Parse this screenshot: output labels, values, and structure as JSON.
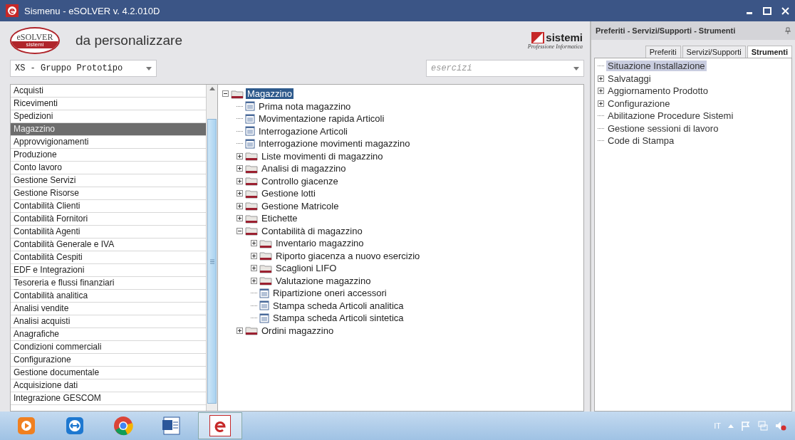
{
  "window": {
    "title": "Sismenu - eSOLVER v. 4.2.010D"
  },
  "header": {
    "logo": "eSOLVER",
    "logo_sub": "sistemi",
    "title": "da personalizzare",
    "brand": "sistemi",
    "brand_tagline": "Professione Informatica"
  },
  "company_select": {
    "value": "XS - Gruppo Prototipo"
  },
  "year_select": {
    "placeholder": "esercizi"
  },
  "modules": [
    {
      "label": "Acquisti",
      "selected": false
    },
    {
      "label": "Ricevimenti",
      "selected": false
    },
    {
      "label": "Spedizioni",
      "selected": false
    },
    {
      "label": "Magazzino",
      "selected": true
    },
    {
      "label": "Approvvigionamenti",
      "selected": false
    },
    {
      "label": "Produzione",
      "selected": false
    },
    {
      "label": "Conto lavoro",
      "selected": false
    },
    {
      "label": "Gestione Servizi",
      "selected": false
    },
    {
      "label": "Gestione Risorse",
      "selected": false
    },
    {
      "label": "Contabilità Clienti",
      "selected": false
    },
    {
      "label": "Contabilità Fornitori",
      "selected": false
    },
    {
      "label": "Contabilità Agenti",
      "selected": false
    },
    {
      "label": "Contabilità Generale e IVA",
      "selected": false
    },
    {
      "label": "Contabilità Cespiti",
      "selected": false
    },
    {
      "label": "EDF e Integrazioni",
      "selected": false
    },
    {
      "label": "Tesoreria e flussi finanziari",
      "selected": false
    },
    {
      "label": "Contabilità analitica",
      "selected": false
    },
    {
      "label": "Analisi vendite",
      "selected": false
    },
    {
      "label": "Analisi acquisti",
      "selected": false
    },
    {
      "label": "Anagrafiche",
      "selected": false
    },
    {
      "label": "Condizioni commerciali",
      "selected": false
    },
    {
      "label": "Configurazione",
      "selected": false
    },
    {
      "label": "Gestione documentale",
      "selected": false
    },
    {
      "label": "Acquisizione dati",
      "selected": false
    },
    {
      "label": "Integrazione GESCOM",
      "selected": false
    }
  ],
  "menu_tree": [
    {
      "label": "Magazzino",
      "kind": "folder",
      "expanded": true,
      "selected": true,
      "children": [
        {
          "label": "Prima nota magazzino",
          "kind": "doc",
          "selected": false
        },
        {
          "label": "Movimentazione rapida Articoli",
          "kind": "doc",
          "selected": false
        },
        {
          "label": "Interrogazione Articoli",
          "kind": "doc",
          "selected": false
        },
        {
          "label": "Interrogazione movimenti magazzino",
          "kind": "doc",
          "selected": false
        },
        {
          "label": "Liste movimenti di magazzino",
          "kind": "folder",
          "expanded": false,
          "selected": false
        },
        {
          "label": "Analisi di magazzino",
          "kind": "folder",
          "expanded": false,
          "selected": false
        },
        {
          "label": "Controllo giacenze",
          "kind": "folder",
          "expanded": false,
          "selected": false
        },
        {
          "label": "Gestione lotti",
          "kind": "folder",
          "expanded": false,
          "selected": false
        },
        {
          "label": "Gestione Matricole",
          "kind": "folder",
          "expanded": false,
          "selected": false
        },
        {
          "label": "Etichette",
          "kind": "folder",
          "expanded": false,
          "selected": false
        },
        {
          "label": "Contabilità di magazzino",
          "kind": "folder",
          "expanded": true,
          "selected": false,
          "children": [
            {
              "label": "Inventario magazzino",
              "kind": "folder",
              "expanded": false,
              "selected": false
            },
            {
              "label": "Riporto giacenza a nuovo esercizio",
              "kind": "folder",
              "expanded": false,
              "selected": false
            },
            {
              "label": "Scaglioni LIFO",
              "kind": "folder",
              "expanded": false,
              "selected": false
            },
            {
              "label": "Valutazione magazzino",
              "kind": "folder",
              "expanded": false,
              "selected": false
            },
            {
              "label": "Ripartizione oneri accessori",
              "kind": "doc",
              "selected": false
            },
            {
              "label": "Stampa scheda Articoli analitica",
              "kind": "doc",
              "selected": false
            },
            {
              "label": "Stampa scheda Articoli sintetica",
              "kind": "doc",
              "selected": false
            }
          ]
        },
        {
          "label": "Ordini magazzino",
          "kind": "folder",
          "expanded": false,
          "selected": false
        }
      ]
    }
  ],
  "side_panel": {
    "title": "Preferiti - Servizi/Supporti - Strumenti",
    "tabs": [
      {
        "label": "Preferiti",
        "selected": false
      },
      {
        "label": "Servizi/Supporti",
        "selected": false
      },
      {
        "label": "Strumenti",
        "selected": true
      }
    ],
    "tree": [
      {
        "label": "Situazione Installazione",
        "kind": "leaf",
        "selected": true
      },
      {
        "label": "Salvataggi",
        "kind": "group",
        "expanded": false,
        "selected": false
      },
      {
        "label": "Aggiornamento Prodotto",
        "kind": "group",
        "expanded": false,
        "selected": false
      },
      {
        "label": "Configurazione",
        "kind": "group",
        "expanded": false,
        "selected": false
      },
      {
        "label": "Abilitazione Procedure Sistemi",
        "kind": "leaf",
        "selected": false
      },
      {
        "label": "Gestione sessioni di lavoro",
        "kind": "leaf",
        "selected": false
      },
      {
        "label": "Code di Stampa",
        "kind": "leaf",
        "selected": false
      }
    ]
  },
  "taskbar": {
    "language": "IT"
  }
}
